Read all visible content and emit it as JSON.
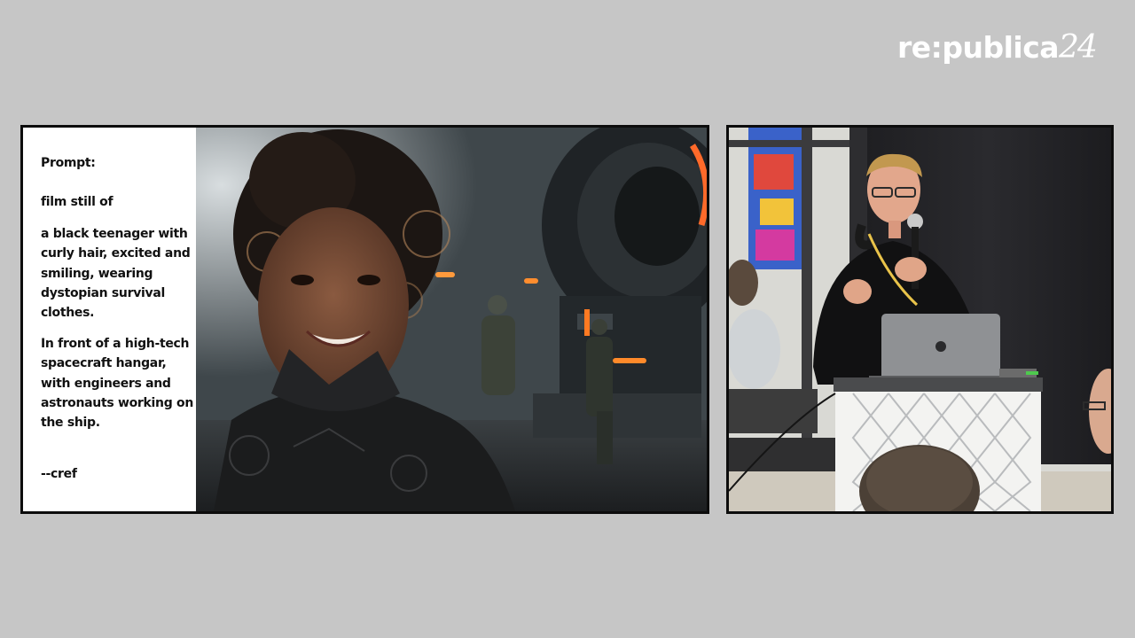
{
  "logo": {
    "brand": "re:publica",
    "year": "24"
  },
  "slide": {
    "prompt_heading": "Prompt:",
    "lines": [
      "film still of",
      "a black teenager with curly hair, excited and smiling, wearing dystopian survival clothes.",
      "In front of a high-tech spacecraft hangar, with engineers and astronauts working on the ship.",
      "--cref"
    ]
  },
  "images": {
    "generated": "ai-generated-film-still",
    "speaker": "speaker-camera-feed"
  },
  "colors": {
    "background": "#c6c6c6",
    "frame": "#0c0c0c",
    "text": "#111111",
    "logo": "#ffffff",
    "accent_orange": "#ff6a2a"
  }
}
